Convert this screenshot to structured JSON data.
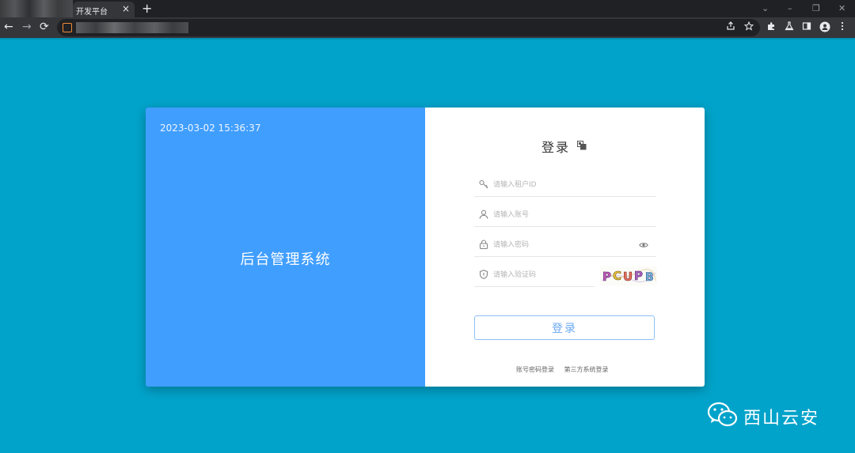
{
  "browser": {
    "tab_title": "开发平台",
    "tab_close": "×",
    "new_tab": "+",
    "window_controls": [
      "⌄",
      "–",
      "❐",
      "✕"
    ],
    "nav": {
      "back": "←",
      "forward": "→",
      "reload": "⟳"
    },
    "toolbar_icons": [
      "share-icon",
      "star-icon",
      "extensions-icon",
      "lab-icon",
      "sidepanel-icon",
      "profile-icon",
      "menu-icon"
    ]
  },
  "login_panel": {
    "datetime": "2023-03-02 15:36:37",
    "system_title": "后台管理系统",
    "login_title": "登录",
    "tenant_placeholder": "请输入租户ID",
    "account_placeholder": "请输入账号",
    "password_placeholder": "请输入密码",
    "captcha_placeholder": "请输入验证码",
    "captcha_text": "PCUPB",
    "login_button": "登录",
    "links": [
      "账号密码登录",
      "第三方系统登录"
    ]
  },
  "watermark": {
    "text": "西山云安"
  },
  "colors": {
    "background": "#02a3ca",
    "left_panel": "#409eff",
    "button_border": "#8bc0f8"
  }
}
